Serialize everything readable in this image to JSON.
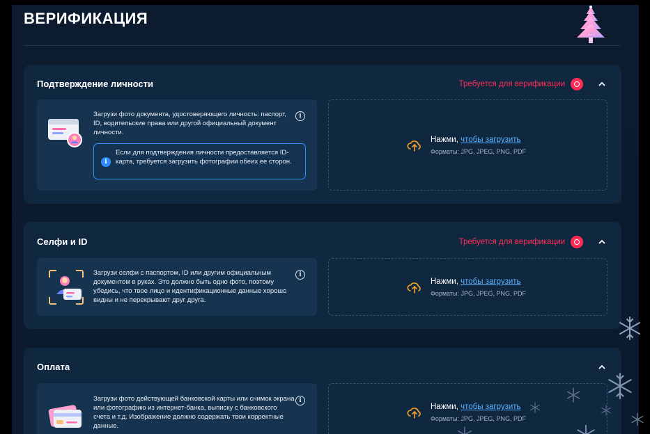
{
  "page": {
    "title": "ВЕРИФИКАЦИЯ"
  },
  "sections": [
    {
      "title": "Подтверждение личности",
      "status": "Требуется для верификации",
      "description": "Загрузи фото документа, удостоверяющего личность: паспорт, ID, водительские права или другой официальный документ личности.",
      "note": "Если для подтверждения личности предоставляется ID-карта, требуется загрузить фотографии обеих ее сторон.",
      "upload": {
        "prefix": "Нажми, ",
        "link": "чтобы загрузить",
        "formats": "Форматы: JPG, JPEG, PNG, PDF"
      }
    },
    {
      "title": "Селфи и ID",
      "status": "Требуется для верификации",
      "description": "Загрузи селфи с паспортом, ID или другим официальным документом в руках. Это должно быть одно фото, поэтому убедись, что твое лицо и идентификационные данные хорошо видны и не перекрывают друг друга.",
      "upload": {
        "prefix": "Нажми, ",
        "link": "чтобы загрузить",
        "formats": "Форматы: JPG, JPEG, PNG, PDF"
      }
    },
    {
      "title": "Оплата",
      "description": "Загрузи фото действующей банковской карты или снимок экрана или фотографию из интернет-банка, выписку с банковского счета и т.д. Изображение должно содержать твои корректные данные.",
      "upload": {
        "prefix": "Нажми, ",
        "link": "чтобы загрузить",
        "formats": "Форматы: JPG, JPEG, PNG, PDF"
      }
    }
  ],
  "colors": {
    "background": "#0c1b2e",
    "card": "#102740",
    "required": "#ff2d55",
    "link": "#5ab3ff",
    "upload_icon": "#f5a524"
  }
}
